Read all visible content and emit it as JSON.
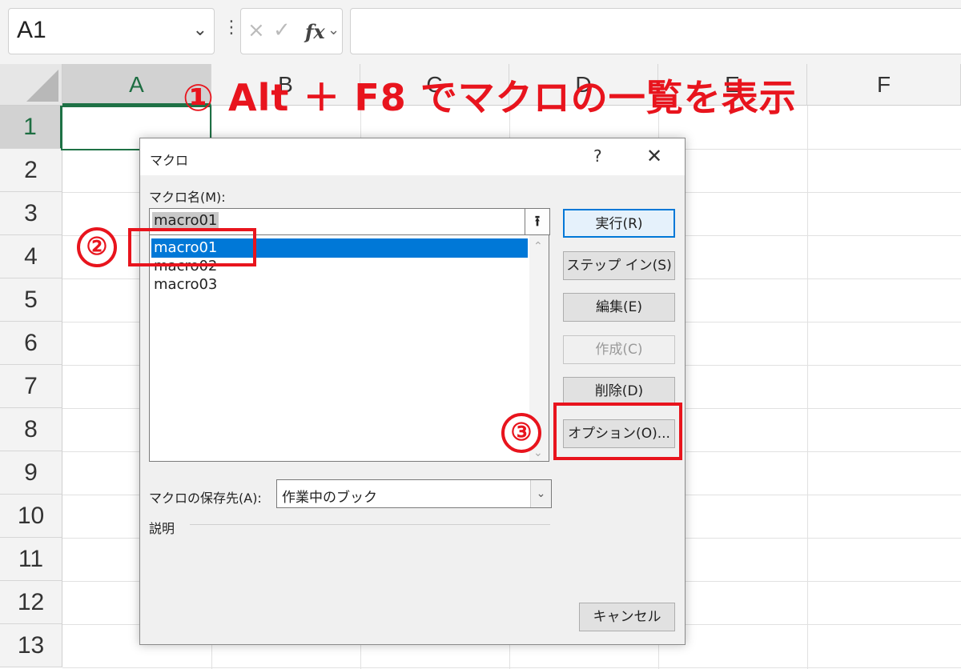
{
  "namebox": {
    "value": "A1"
  },
  "formula": {
    "cancel_icon": "×",
    "enter_icon": "✓",
    "fx_label": "fx"
  },
  "columns": [
    "A",
    "B",
    "C",
    "D",
    "E",
    "F"
  ],
  "rows": [
    "1",
    "2",
    "3",
    "4",
    "5",
    "6",
    "7",
    "8",
    "9",
    "10",
    "11",
    "12",
    "13"
  ],
  "annotation": {
    "title": "① Alt ＋ F8 でマクロの一覧を表示",
    "step2": "②",
    "step3": "③"
  },
  "dialog": {
    "title": "マクロ",
    "help": "?",
    "close": "✕",
    "macro_name_label": "マクロ名(M):",
    "macro_name_value": "macro01",
    "macros": [
      "macro01",
      "macro02",
      "macro03"
    ],
    "buttons": {
      "run": "実行(R)",
      "step_in": "ステップ イン(S)",
      "edit": "編集(E)",
      "create": "作成(C)",
      "delete": "削除(D)",
      "options": "オプション(O)...",
      "cancel": "キャンセル"
    },
    "location_label": "マクロの保存先(A):",
    "location_value": "作業中のブック",
    "description_label": "説明"
  },
  "colors": {
    "accent_red": "#e8141d",
    "excel_green": "#1e7145",
    "selection_blue": "#0078d7"
  }
}
